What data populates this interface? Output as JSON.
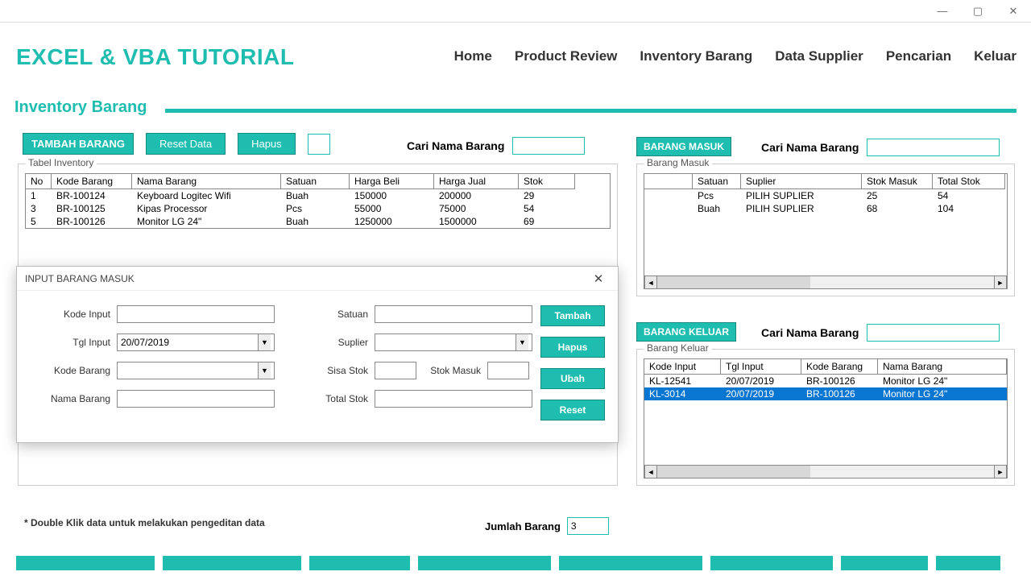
{
  "window": {
    "title": ""
  },
  "app_title": "EXCEL & VBA TUTORIAL",
  "nav": [
    "Home",
    "Product Review",
    "Inventory Barang",
    "Data Supplier",
    "Pencarian",
    "Keluar"
  ],
  "section_title": "Inventory Barang",
  "toolbar": {
    "tambah": "TAMBAH BARANG",
    "reset": "Reset Data",
    "hapus": "Hapus"
  },
  "search": {
    "label": "Cari Nama Barang"
  },
  "fieldsets": {
    "inventory": "Tabel Inventory",
    "masuk": "Barang Masuk",
    "keluar": "Barang Keluar"
  },
  "panels": {
    "masuk": "BARANG MASUK",
    "keluar": "BARANG KELUAR"
  },
  "table_inventory": {
    "headers": [
      "No",
      "Kode Barang",
      "Nama Barang",
      "Satuan",
      "Harga Beli",
      "Harga Jual",
      "Stok"
    ],
    "rows": [
      [
        "1",
        "BR-100124",
        "Keyboard Logitec Wifi",
        "Buah",
        "150000",
        "200000",
        "29"
      ],
      [
        "3",
        "BR-100125",
        "Kipas Processor",
        "Pcs",
        "55000",
        "75000",
        "54"
      ],
      [
        "5",
        "BR-100126",
        "Monitor LG 24\"",
        "Buah",
        "1250000",
        "1500000",
        "69"
      ]
    ]
  },
  "table_masuk": {
    "headers": [
      "",
      "Satuan",
      "Suplier",
      "Stok Masuk",
      "Total Stok"
    ],
    "rows": [
      [
        "",
        "Pcs",
        "PILIH SUPLIER",
        "25",
        "54"
      ],
      [
        "",
        "Buah",
        "PILIH SUPLIER",
        "68",
        "104"
      ]
    ]
  },
  "table_keluar": {
    "headers": [
      "Kode Input",
      "Tgl Input",
      "Kode Barang",
      "Nama Barang"
    ],
    "rows": [
      {
        "cells": [
          "KL-12541",
          "20/07/2019",
          "BR-100126",
          "Monitor LG 24\""
        ],
        "selected": false
      },
      {
        "cells": [
          "KL-3014",
          "20/07/2019",
          "BR-100126",
          "Monitor LG 24\""
        ],
        "selected": true
      }
    ]
  },
  "footer_note": "* Double Klik data untuk melakukan pengeditan data",
  "jumlah": {
    "label": "Jumlah Barang",
    "value": "3"
  },
  "dialog": {
    "title": "INPUT BARANG MASUK",
    "labels": {
      "kode_input": "Kode Input",
      "tgl_input": "Tgl Input",
      "kode_barang": "Kode Barang",
      "nama_barang": "Nama Barang",
      "satuan": "Satuan",
      "suplier": "Suplier",
      "sisa_stok": "Sisa Stok",
      "stok_masuk": "Stok Masuk",
      "total_stok": "Total Stok"
    },
    "values": {
      "tgl_input": "20/07/2019"
    },
    "buttons": {
      "tambah": "Tambah",
      "hapus": "Hapus",
      "ubah": "Ubah",
      "reset": "Reset"
    }
  }
}
